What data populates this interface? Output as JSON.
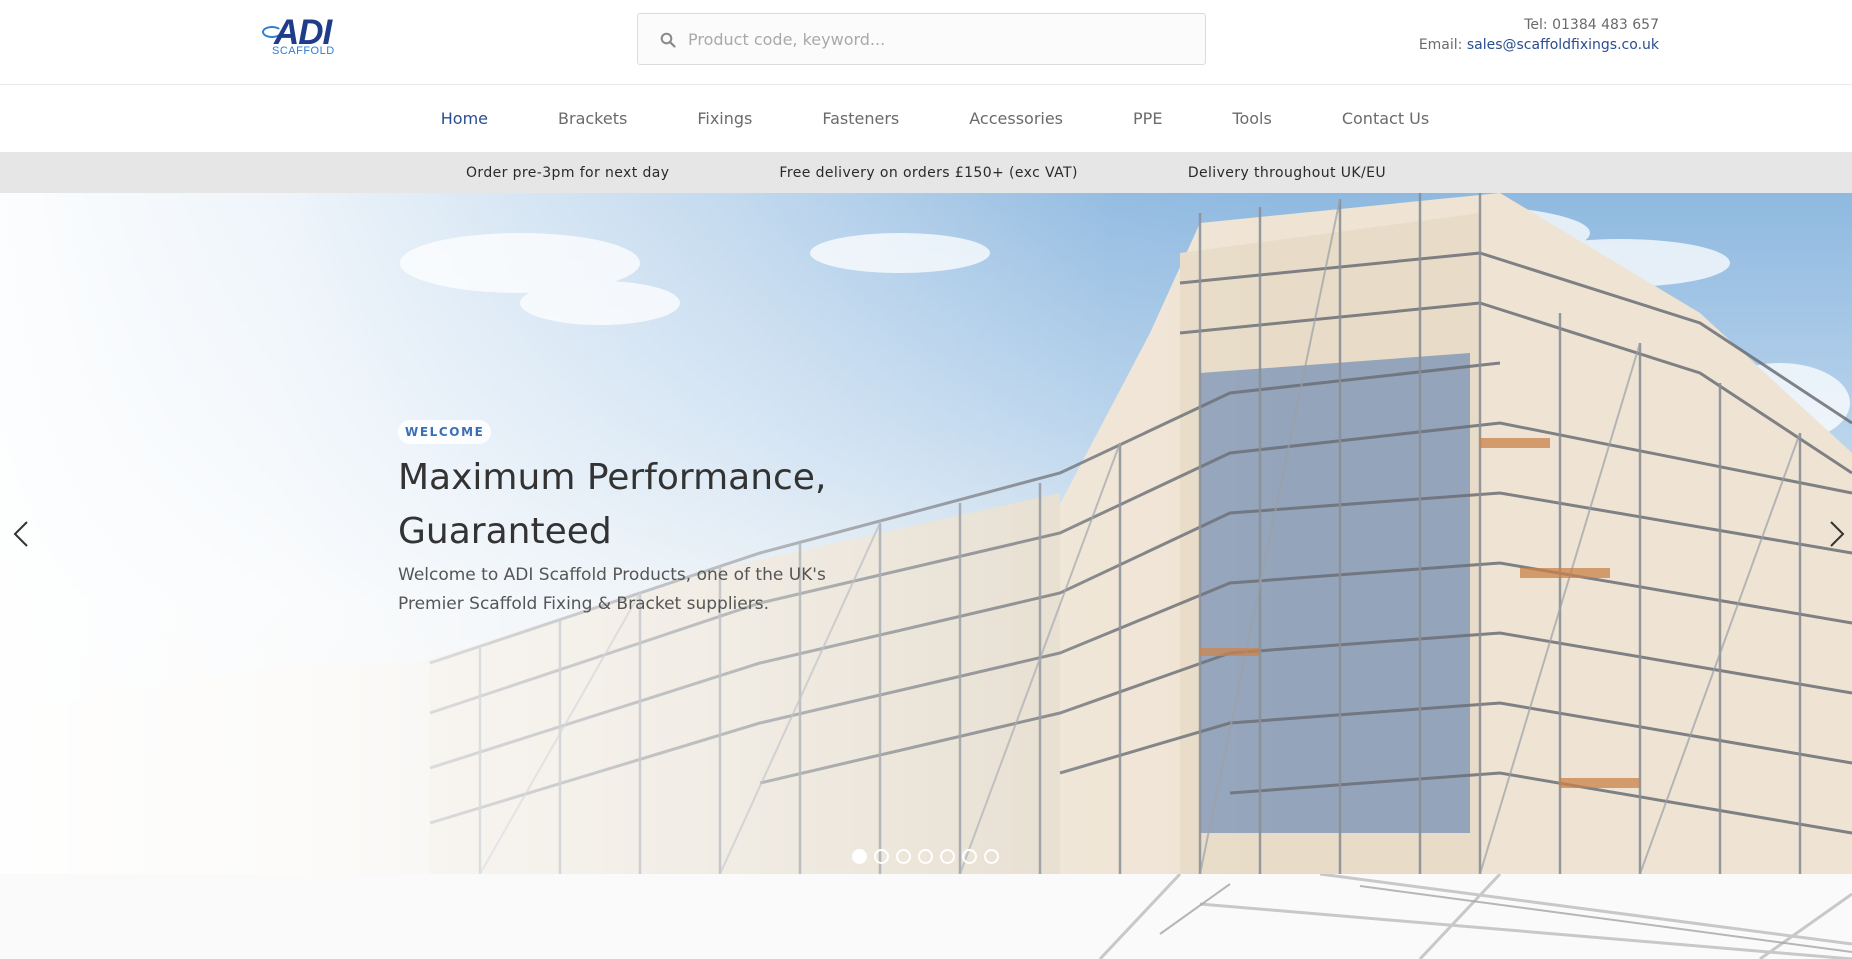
{
  "brand": {
    "logo_main": "ADI",
    "logo_sub": "SCAFFOLD"
  },
  "search": {
    "placeholder": "Product code, keyword..."
  },
  "contact": {
    "tel_label": "Tel:",
    "tel": "01384 483 657",
    "email_label": "Email:",
    "email": "sales@scaffoldfixings.co.uk"
  },
  "nav": {
    "items": [
      {
        "label": "Home",
        "active": true
      },
      {
        "label": "Brackets"
      },
      {
        "label": "Fixings"
      },
      {
        "label": "Fasteners"
      },
      {
        "label": "Accessories"
      },
      {
        "label": "PPE"
      },
      {
        "label": "Tools"
      },
      {
        "label": "Contact Us"
      }
    ]
  },
  "infobar": {
    "items": [
      "Order pre-3pm for next day",
      "Free delivery on orders £150+ (exc VAT)",
      "Delivery throughout UK/EU"
    ]
  },
  "hero": {
    "badge": "WELCOME",
    "title": "Maximum Performance, Guaranteed",
    "text": "Welcome to ADI Scaffold Products, one of the UK's Premier Scaffold Fixing & Bracket suppliers.",
    "slides_total": 7,
    "active_slide": 1
  },
  "icons": {
    "search": "search-icon",
    "prev": "chevron-left-icon",
    "next": "chevron-right-icon"
  },
  "colors": {
    "brand_blue": "#1f3c8a",
    "accent_blue": "#2d7fd0",
    "link": "#2a4d8f",
    "infobar_bg": "#e6e6e6"
  }
}
